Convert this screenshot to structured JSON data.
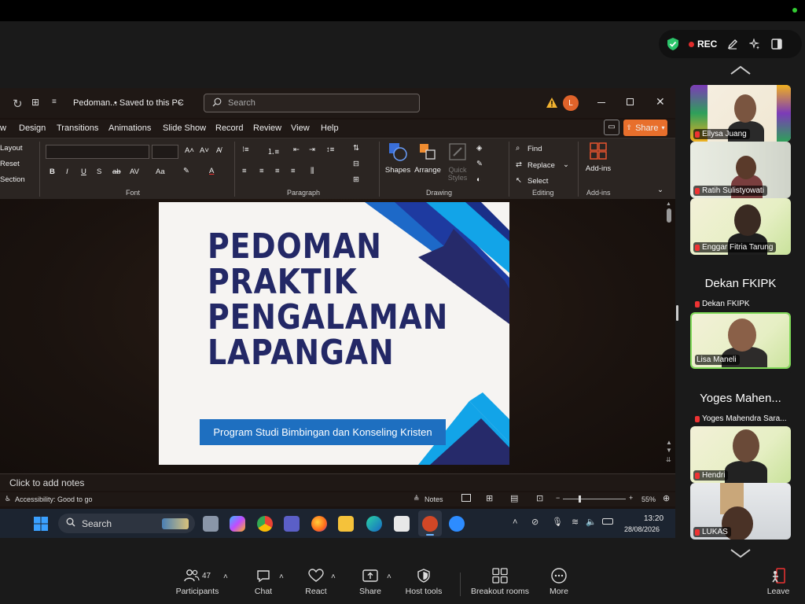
{
  "meeting": {
    "rec_label": "REC",
    "toolbar": {
      "participants_label": "Participants",
      "participants_count": "47",
      "chat_label": "Chat",
      "react_label": "React",
      "share_label": "Share",
      "host_tools_label": "Host tools",
      "breakout_label": "Breakout rooms",
      "more_label": "More",
      "leave_label": "Leave"
    },
    "participants": [
      {
        "name": "Ellysa Juang",
        "video": true
      },
      {
        "name": "Ratih Sulistyowati",
        "video": true
      },
      {
        "name": "Enggar Fitria Tarung",
        "video": true
      },
      {
        "name": "Dekan FKIPK",
        "display": "Dekan FKIPK",
        "video": false
      },
      {
        "name": "Lisa Maneli",
        "video": true,
        "active_speaker": true
      },
      {
        "name": "Yoges Mahendra Sara...",
        "display": "Yoges Mahen...",
        "video": false
      },
      {
        "name": "Hendri",
        "video": true
      },
      {
        "name": "LUKAS",
        "video": true
      }
    ]
  },
  "powerpoint": {
    "file_title": "Pedoman...",
    "save_status": "• Saved to this PC",
    "search_placeholder": "Search",
    "user_initial": "L",
    "share_btn": "Share",
    "tabs": [
      "w",
      "Design",
      "Transitions",
      "Animations",
      "Slide Show",
      "Record",
      "Review",
      "View",
      "Help"
    ],
    "ribbon": {
      "slides_items": [
        "Layout",
        "Reset",
        "Section"
      ],
      "groups": {
        "font": "Font",
        "paragraph": "Paragraph",
        "drawing": "Drawing",
        "editing": "Editing",
        "addins": "Add-ins"
      },
      "drawing_items": [
        "Shapes",
        "Arrange",
        "Quick Styles"
      ],
      "editing_items": [
        "Find",
        "Replace",
        "Select"
      ],
      "addins_item": "Add-ins"
    },
    "slide": {
      "title_lines": [
        "PEDOMAN",
        "PRAKTIK",
        "PENGALAMAN",
        "LAPANGAN"
      ],
      "subtitle": "Program Studi Bimbingan dan Konseling Kristen"
    },
    "notes_placeholder": "Click to add notes",
    "status": {
      "accessibility": "Accessibility: Good to go",
      "notes_label": "Notes",
      "zoom": "55%"
    }
  },
  "taskbar": {
    "search_label": "Search",
    "time": "13:20",
    "date": "28/08/2026"
  },
  "colors": {
    "slide_title": "#232866",
    "accent_blue": "#1e6fc0",
    "share_orange": "#e86f2c",
    "rec_red": "#e02b2b",
    "active_border": "#7ed957"
  }
}
